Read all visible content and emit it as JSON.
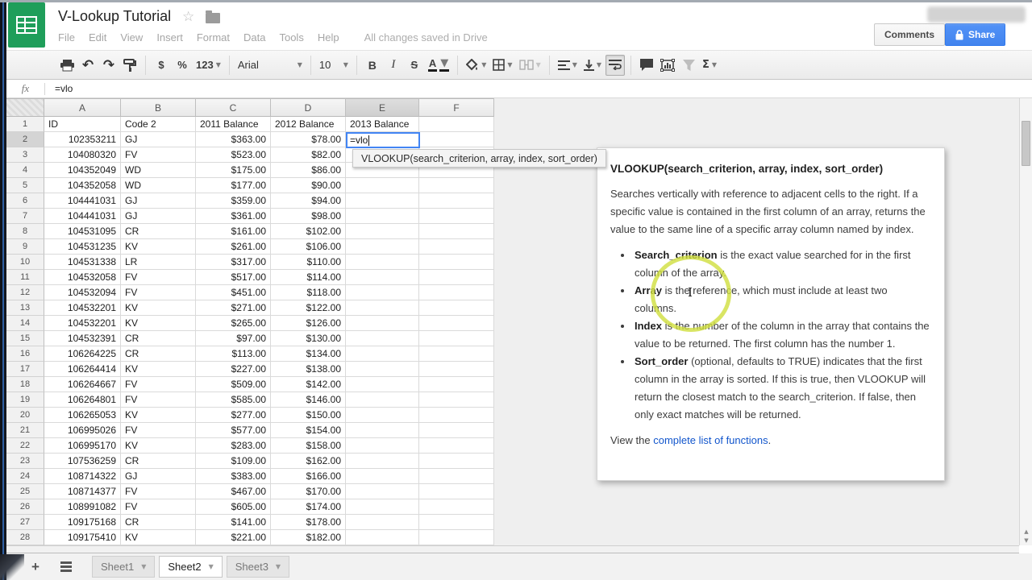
{
  "colors": {
    "accent_blue": "#4285f4",
    "share_blue": "#4d90fe",
    "link_blue": "#1155cc",
    "sheets_green": "#1f9e5a",
    "highlight_yellow": "#cfde3d"
  },
  "header": {
    "doc_title": "V-Lookup Tutorial",
    "menu_items": [
      "File",
      "Edit",
      "View",
      "Insert",
      "Format",
      "Data",
      "Tools",
      "Help"
    ],
    "save_status": "All changes saved in Drive",
    "comments_label": "Comments",
    "share_label": "Share"
  },
  "toolbar": {
    "currency_label": "$",
    "percent_label": "%",
    "format_label": "123",
    "font_name": "Arial",
    "font_size": "10",
    "bold_label": "B",
    "italic_label": "I",
    "strike_label": "S",
    "text_color_label": "A",
    "sigma_label": "Σ"
  },
  "formula_bar": {
    "fx_label": "fx",
    "value": "=vlo"
  },
  "grid": {
    "columns": [
      "A",
      "B",
      "C",
      "D",
      "E",
      "F"
    ],
    "active_col": "E",
    "active_row": 2,
    "active_cell": {
      "ref": "E2",
      "value": "=vlo"
    },
    "rows": [
      [
        "ID",
        "Code 2",
        "2011 Balance",
        "2012 Balance",
        "2013 Balance",
        ""
      ],
      [
        "102353211",
        "GJ",
        "$363.00",
        "$78.00",
        "",
        ""
      ],
      [
        "104080320",
        "FV",
        "$523.00",
        "$82.00",
        "",
        ""
      ],
      [
        "104352049",
        "WD",
        "$175.00",
        "$86.00",
        "",
        ""
      ],
      [
        "104352058",
        "WD",
        "$177.00",
        "$90.00",
        "",
        ""
      ],
      [
        "104441031",
        "GJ",
        "$359.00",
        "$94.00",
        "",
        ""
      ],
      [
        "104441031",
        "GJ",
        "$361.00",
        "$98.00",
        "",
        ""
      ],
      [
        "104531095",
        "CR",
        "$161.00",
        "$102.00",
        "",
        ""
      ],
      [
        "104531235",
        "KV",
        "$261.00",
        "$106.00",
        "",
        ""
      ],
      [
        "104531338",
        "LR",
        "$317.00",
        "$110.00",
        "",
        ""
      ],
      [
        "104532058",
        "FV",
        "$517.00",
        "$114.00",
        "",
        ""
      ],
      [
        "104532094",
        "FV",
        "$451.00",
        "$118.00",
        "",
        ""
      ],
      [
        "104532201",
        "KV",
        "$271.00",
        "$122.00",
        "",
        ""
      ],
      [
        "104532201",
        "KV",
        "$265.00",
        "$126.00",
        "",
        ""
      ],
      [
        "104532391",
        "CR",
        "$97.00",
        "$130.00",
        "",
        ""
      ],
      [
        "106264225",
        "CR",
        "$113.00",
        "$134.00",
        "",
        ""
      ],
      [
        "106264414",
        "KV",
        "$227.00",
        "$138.00",
        "",
        ""
      ],
      [
        "106264667",
        "FV",
        "$509.00",
        "$142.00",
        "",
        ""
      ],
      [
        "106264801",
        "FV",
        "$585.00",
        "$146.00",
        "",
        ""
      ],
      [
        "106265053",
        "KV",
        "$277.00",
        "$150.00",
        "",
        ""
      ],
      [
        "106995026",
        "FV",
        "$577.00",
        "$154.00",
        "",
        ""
      ],
      [
        "106995170",
        "KV",
        "$283.00",
        "$158.00",
        "",
        ""
      ],
      [
        "107536259",
        "CR",
        "$109.00",
        "$162.00",
        "",
        ""
      ],
      [
        "108714322",
        "GJ",
        "$383.00",
        "$166.00",
        "",
        ""
      ],
      [
        "108714377",
        "FV",
        "$467.00",
        "$170.00",
        "",
        ""
      ],
      [
        "108991082",
        "FV",
        "$605.00",
        "$174.00",
        "",
        ""
      ],
      [
        "109175168",
        "CR",
        "$141.00",
        "$178.00",
        "",
        ""
      ],
      [
        "109175410",
        "KV",
        "$221.00",
        "$182.00",
        "",
        ""
      ]
    ]
  },
  "autocomplete": {
    "text": "VLOOKUP(search_criterion, array, index, sort_order)"
  },
  "help_popup": {
    "title": "VLOOKUP(search_criterion, array, index, sort_order)",
    "description": "Searches vertically with reference to adjacent cells to the right. If a specific value is contained in the first column of an array, returns the value to the same line of a specific array column named by index.",
    "bullets": [
      {
        "term": "Search_criterion",
        "text": " is the exact value searched for in the first column of the array."
      },
      {
        "term": "Array",
        "text": " is the reference, which must include at least two columns."
      },
      {
        "term": "Index",
        "text": " is the number of the column in the array that contains the value to be returned. The first column has the number 1."
      },
      {
        "term": "Sort_order",
        "text": " (optional, defaults to TRUE) indicates that the first column in the array is sorted. If this is true, then VLOOKUP will return the closest match to the search_criterion. If false, then only exact matches will be returned."
      }
    ],
    "footer_prefix": "View the ",
    "footer_link": "complete list of functions",
    "footer_suffix": "."
  },
  "sheets_bar": {
    "tabs": [
      "Sheet1",
      "Sheet2",
      "Sheet3"
    ],
    "active_tab": "Sheet2"
  }
}
